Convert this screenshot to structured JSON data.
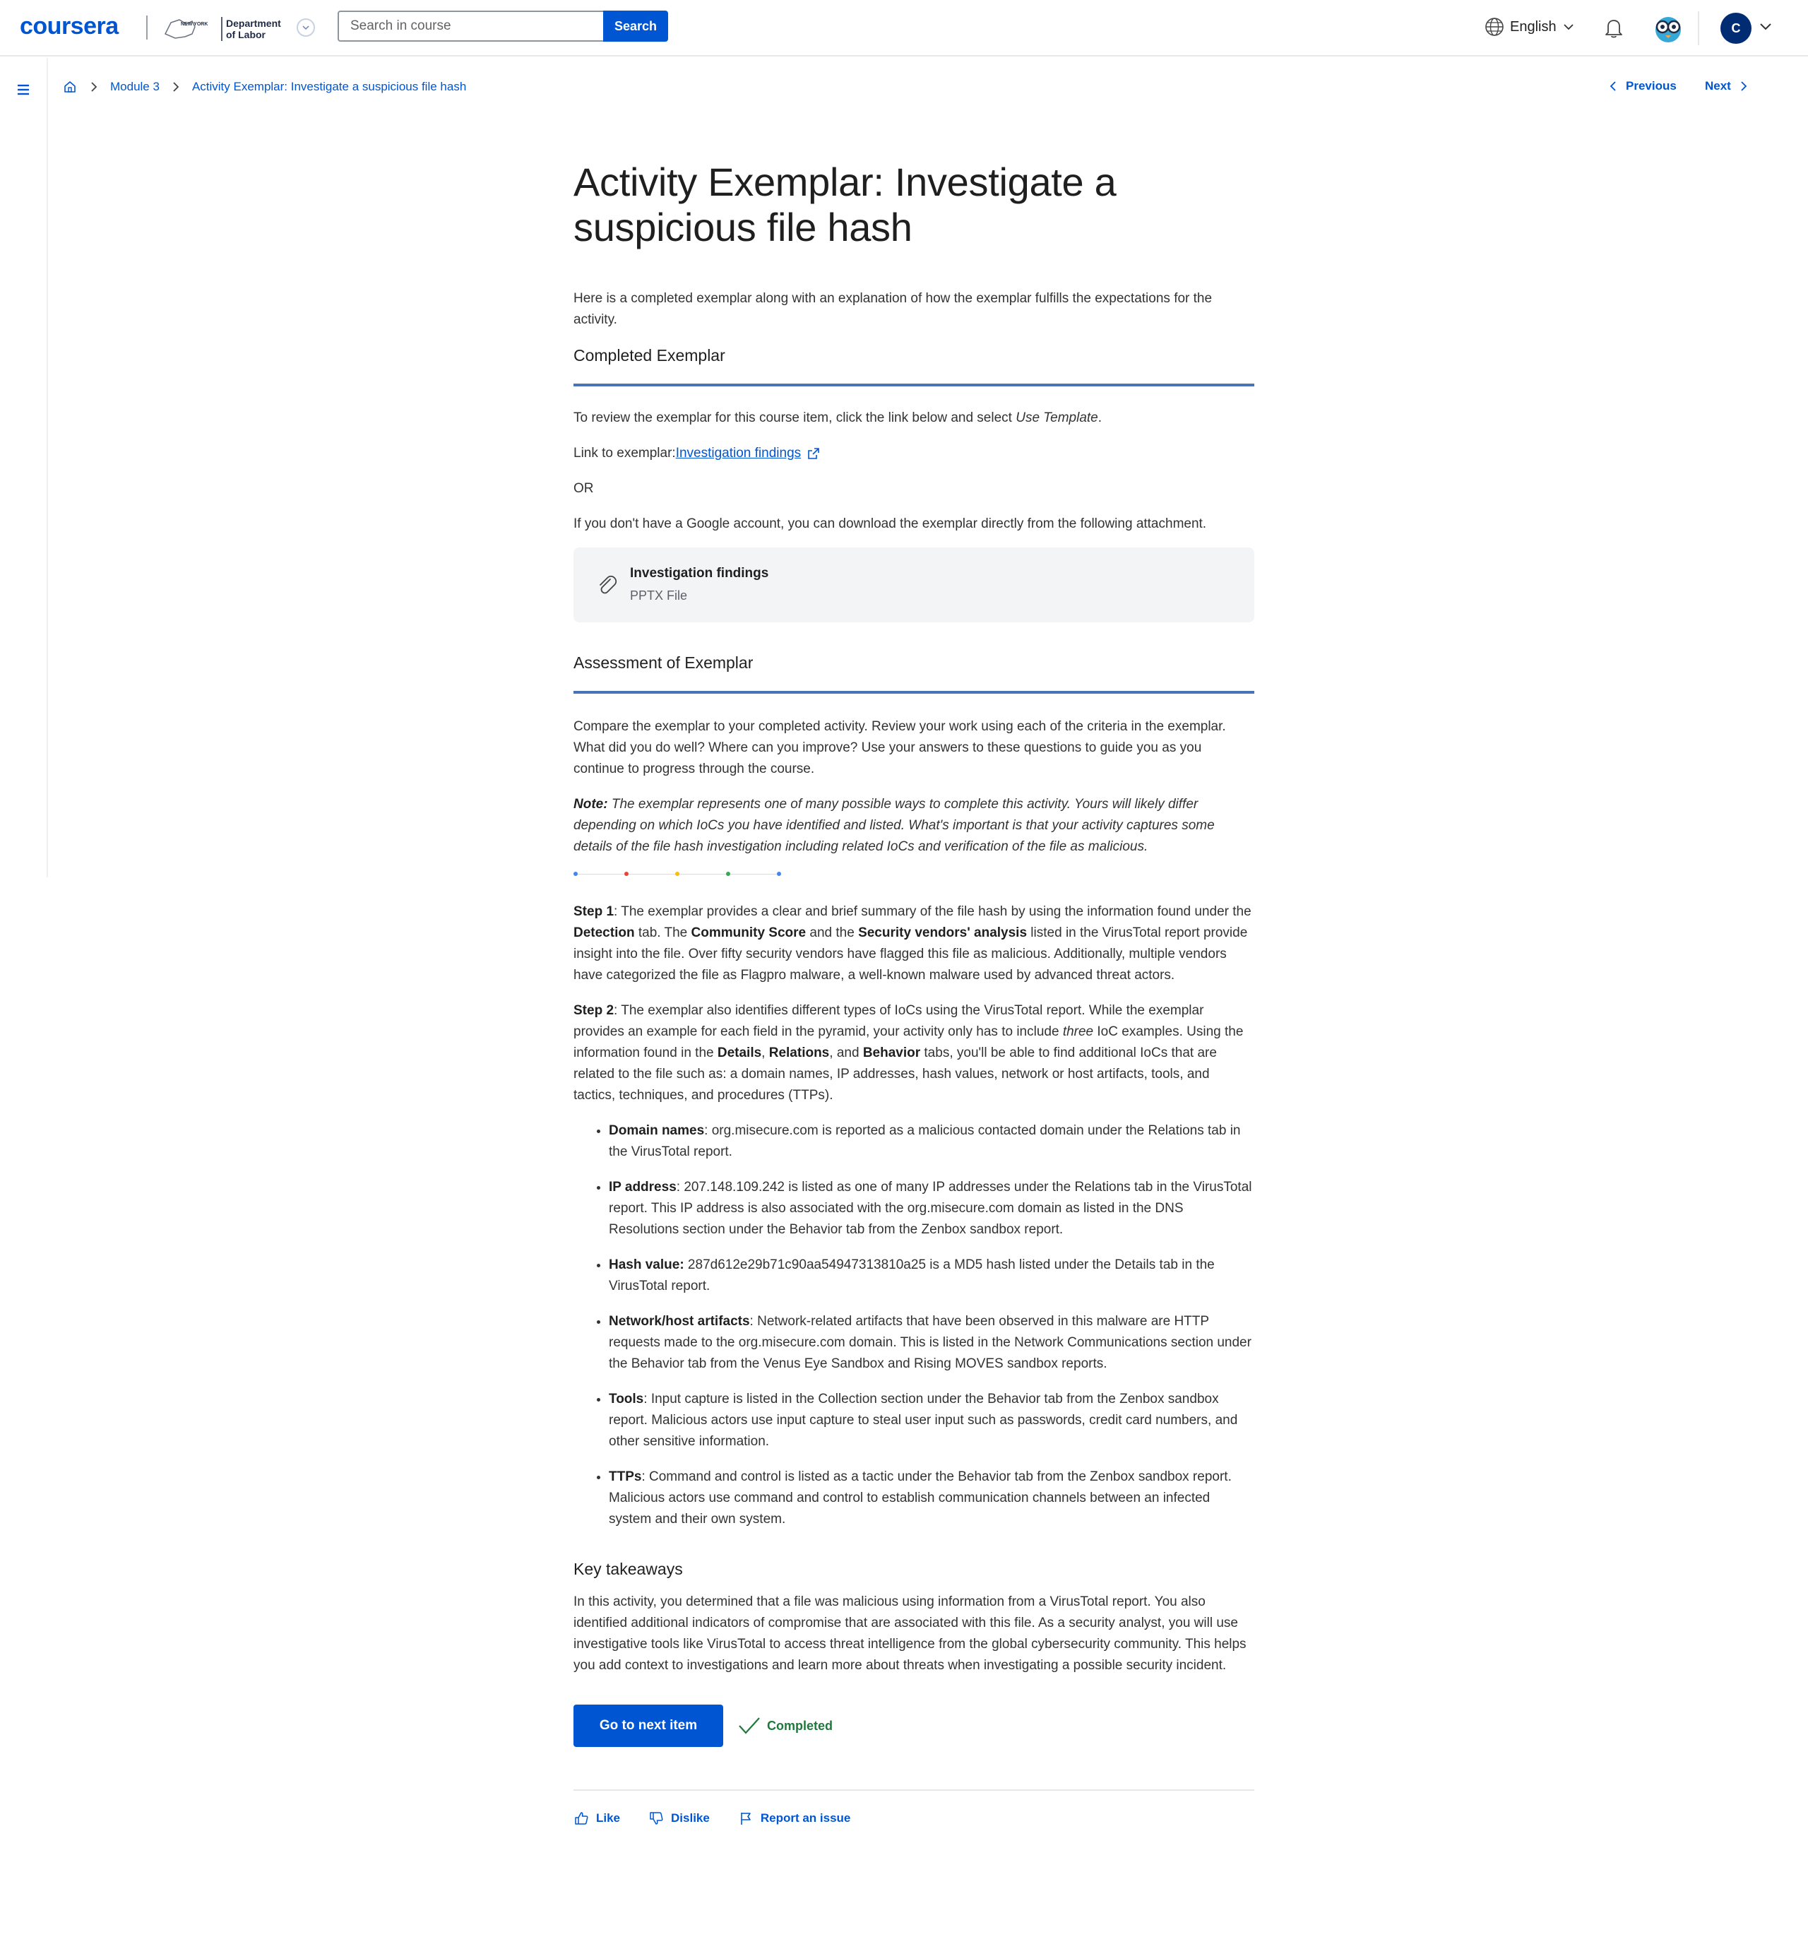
{
  "header": {
    "logo": "coursera",
    "partner": {
      "line1": "NEW YORK",
      "line2": "Department",
      "line3": "of Labor"
    },
    "search": {
      "placeholder": "Search in course",
      "button": "Search"
    },
    "language": "English",
    "avatar_initial": "C"
  },
  "nav": {
    "breadcrumb": [
      "Module 3",
      "Activity Exemplar: Investigate a suspicious file hash"
    ],
    "previous": "Previous",
    "next": "Next"
  },
  "page": {
    "title": "Activity Exemplar: Investigate a suspicious file hash",
    "intro": "Here is a completed exemplar along with an explanation of how the exemplar fulfills the expectations for the activity.",
    "completed_heading": "Completed Exemplar",
    "review_text": "To review the exemplar for this course item, click the link below and select ",
    "review_em": "Use Template",
    "link_label": "Link to exemplar: ",
    "link_text": "Investigation findings",
    "or": "OR",
    "no_google": "If you don't have a Google account, you can download the exemplar directly from the following attachment.",
    "attachment": {
      "name": "Investigation findings",
      "type": "PPTX File"
    },
    "assessment_heading": "Assessment of Exemplar",
    "compare": "Compare the exemplar to your completed activity. Review your work using each of the criteria in the exemplar. What did you do well? Where can you improve? Use your answers to these questions to guide you as you continue to progress through the course.",
    "note_label": "Note:",
    "note": " The exemplar represents one of many possible ways to complete this activity. Yours will likely differ depending on which IoCs you have identified and listed. What's important is that your activity captures some details of the file hash investigation including related IoCs and verification of the file as malicious.",
    "dot_colors": [
      "#4285f4",
      "#ea4335",
      "#fbbc05",
      "#34a853",
      "#4285f4"
    ],
    "step1": {
      "label": "Step 1",
      "t1": ": The exemplar provides a clear and brief summary of the file hash by using the information found under the ",
      "b1": "Detection",
      "t2": " tab. The ",
      "b2": "Community Score",
      "t3": " and the ",
      "b3": "Security vendors' analysis",
      "t4": " listed in the VirusTotal report provide insight into the file. Over fifty security vendors have flagged this file as malicious. Additionally, multiple vendors have categorized the file as Flagpro malware, a well-known malware used by advanced threat actors."
    },
    "step2": {
      "label": "Step 2",
      "t1": ": The exemplar also identifies different types of IoCs using the VirusTotal report. While the exemplar provides an example for each field in the pyramid, your activity only has to include ",
      "em": "three",
      "t2": " IoC examples. Using the information found in the ",
      "b1": "Details",
      "t3": ", ",
      "b2": "Relations",
      "t4": ", and ",
      "b3": "Behavior",
      "t5": " tabs, you'll be able to find additional IoCs that are related to the file such as: a domain names, IP addresses, hash values, network or host artifacts, tools, and tactics, techniques, and procedures (TTPs)."
    },
    "iocs": [
      {
        "label": "Domain names",
        "sep": ":",
        "text": " org.misecure.com is reported as a malicious contacted domain under the Relations tab in the VirusTotal report."
      },
      {
        "label": "IP address",
        "sep": ":",
        "text": " 207.148.109.242 is listed as one of many IP addresses under the Relations tab in the VirusTotal report. This IP address is also associated with the org.misecure.com domain as listed in the DNS Resolutions section under the Behavior tab from the Zenbox sandbox report."
      },
      {
        "label": "Hash value:",
        "sep": "",
        "text": " 287d612e29b71c90aa54947313810a25 is a MD5 hash listed under the Details tab in the VirusTotal report."
      },
      {
        "label": "Network/host artifacts",
        "sep": ":",
        "text": " Network-related artifacts that have been observed in this malware are HTTP requests made to the org.misecure.com domain. This is listed in the Network Communications section under the Behavior tab from the Venus Eye Sandbox and Rising MOVES sandbox reports."
      },
      {
        "label": "Tools",
        "sep": ":",
        "text": " Input capture is listed in the Collection section under the Behavior tab from the Zenbox sandbox report. Malicious actors use input capture to steal user input such as passwords, credit card numbers, and other sensitive information."
      },
      {
        "label": "TTPs",
        "sep": ":",
        "text": " Command and control is listed as a tactic under the Behavior tab from the Zenbox sandbox report. Malicious actors use command and control to establish communication channels between an infected system and their own system."
      }
    ],
    "takeaways_heading": "Key takeaways",
    "takeaways": "In this activity, you determined that a file was malicious using information from a VirusTotal report. You also identified additional indicators of compromise that are associated with this file. As a security analyst, you will use investigative tools like VirusTotal to access threat intelligence from the global cybersecurity community. This helps you add context to investigations and learn more about threats when investigating a possible security incident.",
    "next_button": "Go to next item",
    "completed": "Completed",
    "like": "Like",
    "dislike": "Dislike",
    "report": "Report an issue"
  }
}
